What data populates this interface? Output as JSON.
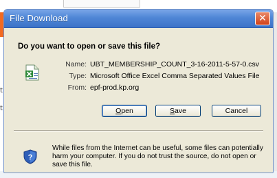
{
  "background": {
    "left_fragments": [
      "t",
      "t"
    ]
  },
  "dialog": {
    "title": "File Download",
    "close_glyph": "✕",
    "heading": "Do you want to open or save this file?",
    "file_icon": "excel-csv-file-icon",
    "fields": [
      {
        "label": "Name:",
        "value": "UBT_MEMBERSHIP_COUNT_3-16-2011-5-57-0.csv"
      },
      {
        "label": "Type:",
        "value": "Microsoft Office Excel Comma Separated Values File"
      },
      {
        "label": "From:",
        "value": "epf-prod.kp.org"
      }
    ],
    "buttons": {
      "open": {
        "prefix": "",
        "accel": "O",
        "suffix": "pen"
      },
      "save": {
        "prefix": "",
        "accel": "S",
        "suffix": "ave"
      },
      "cancel": "Cancel"
    },
    "warning_icon": "shield-question-icon",
    "warning_text": "While files from the Internet can be useful, some files can potentially harm your computer. If you do not trust the source, do not open or save this file."
  },
  "colors": {
    "titlebar": "#4f86d6",
    "close_button": "#d2421a",
    "dialog_bg": "#ece9d8",
    "page_accent": "#f26a21"
  }
}
